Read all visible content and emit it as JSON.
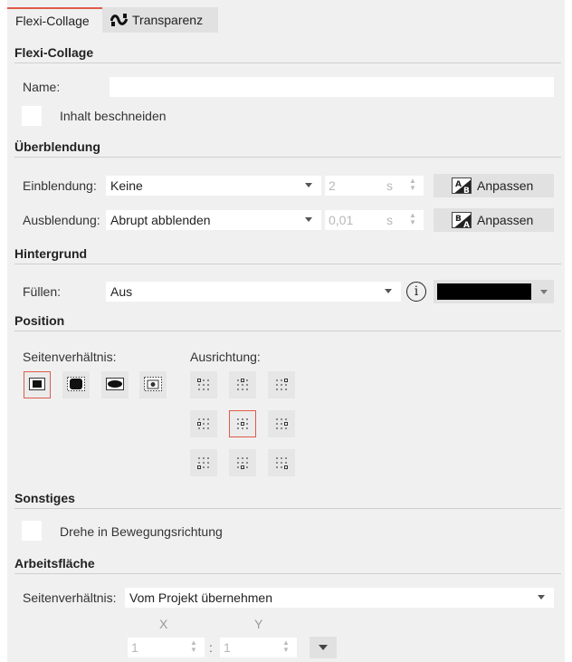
{
  "tabs": [
    {
      "label": "Flexi-Collage",
      "active": true
    },
    {
      "label": "Transparenz",
      "active": false,
      "icon": "transparency-wave-icon"
    }
  ],
  "flexi_collage": {
    "heading": "Flexi-Collage",
    "name_label": "Name:",
    "name_value": "",
    "crop_label": "Inhalt beschneiden",
    "crop_checked": false
  },
  "blend": {
    "heading": "Überblendung",
    "in_label": "Einblendung:",
    "in_value": "Keine",
    "in_duration": "2",
    "in_unit": "s",
    "in_button": "Anpassen",
    "out_label": "Ausblendung:",
    "out_value": "Abrupt abblenden",
    "out_duration": "0,01",
    "out_unit": "s",
    "out_button": "Anpassen"
  },
  "background": {
    "heading": "Hintergrund",
    "fill_label": "Füllen:",
    "fill_value": "Aus",
    "info_icon": "i",
    "color": "#000000"
  },
  "position": {
    "heading": "Position",
    "aspect_label": "Seitenverhältnis:",
    "align_label": "Ausrichtung:",
    "aspect_selected": 0,
    "align_selected": "center"
  },
  "other": {
    "heading": "Sonstiges",
    "rotate_label": "Drehe in Bewegungsrichtung",
    "rotate_checked": false
  },
  "workspace": {
    "heading": "Arbeitsfläche",
    "aspect_label": "Seitenverhältnis:",
    "aspect_value": "Vom Projekt übernehmen",
    "x_label": "X",
    "y_label": "Y",
    "x_value": "1",
    "y_value": "1",
    "separator": ":"
  },
  "colors": {
    "accent": "#e05a4a",
    "panel": "#f0f0f0",
    "button": "#e1e1e1"
  }
}
